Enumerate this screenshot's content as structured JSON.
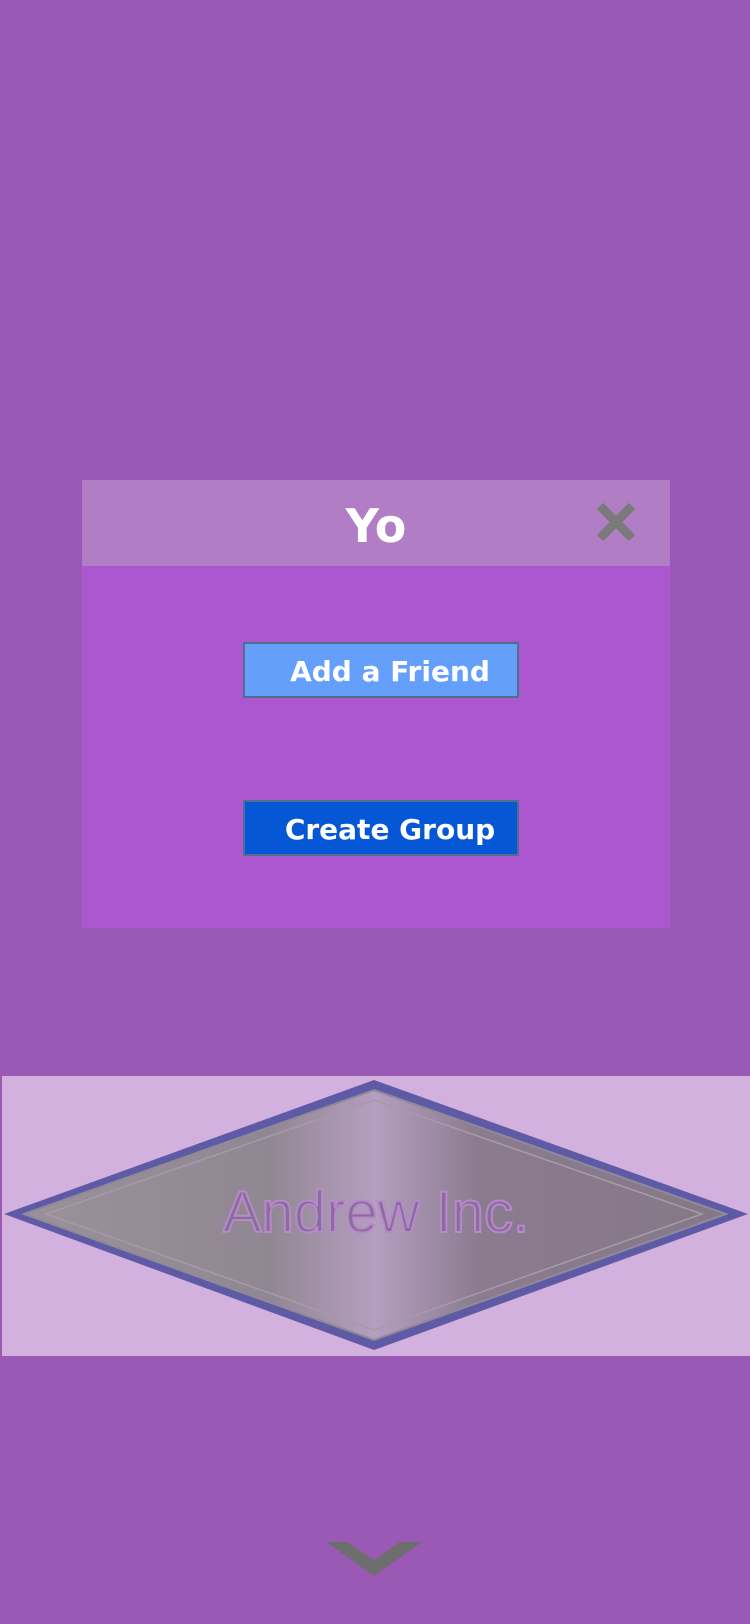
{
  "modal": {
    "title": "Yo",
    "close_icon": "close-icon",
    "add_friend_label": "Add a Friend",
    "create_group_label": "Create Group"
  },
  "banner": {
    "logo_text": "Andrew Inc."
  },
  "footer": {
    "expand_icon": "chevron-down-icon"
  },
  "colors": {
    "background": "#9a59b5",
    "modal_body": "#aa57d0",
    "modal_header": "#b17ec6",
    "add_friend_button": "#64a0fb",
    "create_group_button": "#0557d6",
    "banner_background": "#d2b1de",
    "icon_gray": "#7a7a7a"
  }
}
